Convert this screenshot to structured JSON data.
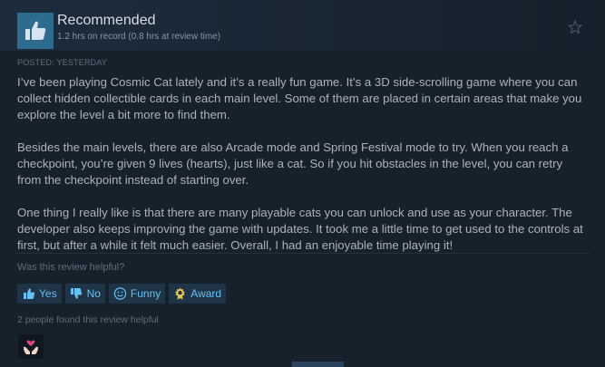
{
  "review": {
    "verdict": "Recommended",
    "hours": "1.2 hrs on record (0.8 hrs at review time)",
    "posted": "POSTED: YESTERDAY",
    "paragraphs": [
      "I’ve been playing Cosmic Cat lately and it’s a really fun game. It’s a 3D side-scrolling game where you can collect hidden collectible cards in each main level. Some of them are placed in certain areas that make you explore the level a bit more to find them.",
      "Besides the main levels, there are also Arcade mode and Spring Festival mode to try. When you reach a checkpoint, you’re given 9 lives (hearts), just like a cat. So if you hit obstacles in the level, you can retry from the checkpoint instead of starting over.",
      "One thing I really like is that there are many playable cats you can unlock and use as your character. The developer also keeps improving the game with updates. It took me a little time to get used to the controls at first, but after a while it felt much easier. Overall, I had an enjoyable time playing it!"
    ]
  },
  "feedback": {
    "question": "Was this review helpful?",
    "yes_label": "Yes",
    "no_label": "No",
    "funny_label": "Funny",
    "award_label": "Award",
    "found_helpful": "2 people found this review helpful"
  },
  "icons": {
    "verdict": "thumbs-up-icon",
    "favorite": "star-icon",
    "award_received": "heart-hands-icon"
  },
  "colors": {
    "background": "#17212c",
    "accent": "#66c0f4",
    "button_bg": "#1f3446",
    "thumb_box": "#2f6a8f"
  }
}
